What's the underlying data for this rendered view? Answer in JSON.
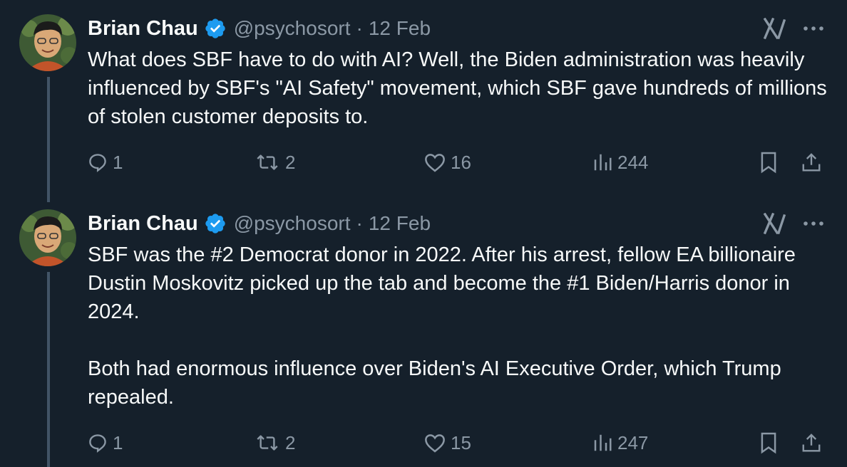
{
  "tweets": [
    {
      "author_name": "Brian Chau",
      "handle": "@psychosort",
      "separator": "·",
      "date": "12 Feb",
      "paragraphs": [
        "What does SBF have to do with AI? Well, the Biden administration was heavily influenced by SBF's \"AI Safety\" movement, which SBF gave hundreds of millions of stolen customer deposits to."
      ],
      "stats": {
        "replies": "1",
        "reposts": "2",
        "likes": "16",
        "views": "244"
      }
    },
    {
      "author_name": "Brian Chau",
      "handle": "@psychosort",
      "separator": "·",
      "date": "12 Feb",
      "paragraphs": [
        "SBF was the #2 Democrat donor in 2022. After his arrest, fellow EA billionaire Dustin Moskovitz picked up the tab and become the #1 Biden/Harris donor in 2024.",
        "Both had enormous influence over Biden's AI Executive Order, which Trump repealed."
      ],
      "stats": {
        "replies": "1",
        "reposts": "2",
        "likes": "15",
        "views": "247"
      }
    }
  ],
  "colors": {
    "background": "#15202b",
    "text_primary": "#f7f9f9",
    "text_secondary": "#8b98a5",
    "verified_badge": "#1d9bf0",
    "thread_line": "#425466"
  },
  "icons": [
    "verified-badge-icon",
    "grok-icon",
    "more-icon",
    "reply-icon",
    "repost-icon",
    "like-icon",
    "views-icon",
    "bookmark-icon",
    "share-icon"
  ]
}
